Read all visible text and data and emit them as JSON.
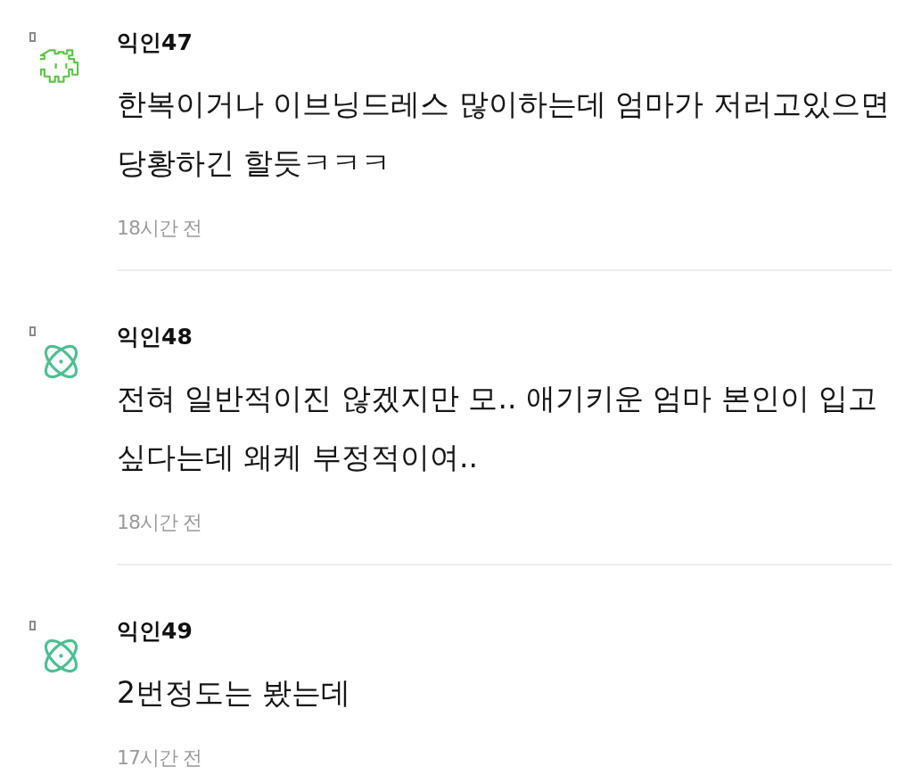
{
  "comments": [
    {
      "author": "익인47",
      "avatar": {
        "kind": "invader",
        "color": "#5cc443"
      },
      "text": "한복이거나 이브닝드레스 많이하는데 엄마가 저러고있으면 당황하긴 할듯ㅋㅋㅋ",
      "time": "18시간 전"
    },
    {
      "author": "익인48",
      "avatar": {
        "kind": "atom",
        "color": "#4dbf90"
      },
      "text": "전혀 일반적이진 않겠지만 모.. 애기키운 엄마 본인이 입고 싶다는데 왜케 부정적이여..",
      "time": "18시간 전"
    },
    {
      "author": "익인49",
      "avatar": {
        "kind": "atom",
        "color": "#4dbf90"
      },
      "text": "2번정도는 봤는데",
      "time": "17시간 전"
    }
  ]
}
